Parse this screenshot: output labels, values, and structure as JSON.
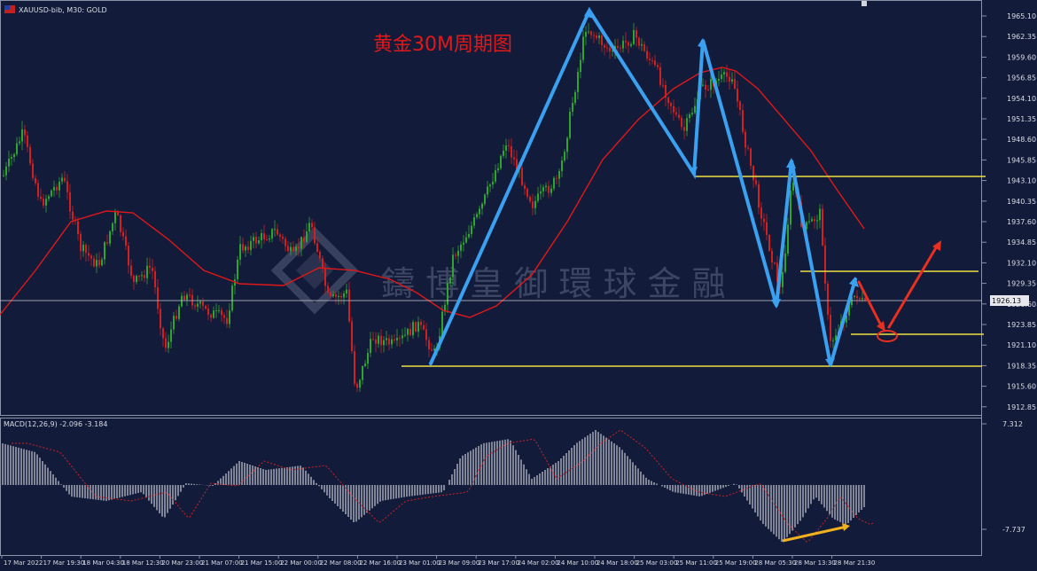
{
  "window": {
    "symbol_header": "XAUUSD-bib, M30: GOLD",
    "annotation_title": "黄金30M周期图",
    "watermark": "鑄 博 皇 御 環 球 金 融",
    "current_price": "1926.13"
  },
  "price_axis": {
    "labels": [
      "1965.10",
      "1962.35",
      "1959.60",
      "1956.85",
      "1954.10",
      "1951.35",
      "1948.60",
      "1945.85",
      "1943.10",
      "1940.35",
      "1937.60",
      "1934.85",
      "1932.10",
      "1929.35",
      "1926.60",
      "1923.85",
      "1921.10",
      "1918.35",
      "1915.60",
      "1912.85"
    ]
  },
  "time_axis": {
    "labels": [
      "17 Mar 2022",
      "17 Mar 19:30",
      "18 Mar 04:30",
      "18 Mar 12:30",
      "20 Mar 23:00",
      "21 Mar 07:00",
      "21 Mar 15:00",
      "22 Mar 00:00",
      "22 Mar 08:00",
      "22 Mar 16:00",
      "23 Mar 01:00",
      "23 Mar 09:00",
      "23 Mar 17:00",
      "24 Mar 02:00",
      "24 Mar 10:00",
      "24 Mar 18:00",
      "25 Mar 03:00",
      "25 Mar 11:00",
      "25 Mar 19:00",
      "28 Mar 05:30",
      "28 Mar 13:30",
      "28 Mar 21:30"
    ]
  },
  "indicator": {
    "label": "MACD(12,26,9) -2.096 -3.184",
    "scale_top": "7.312",
    "scale_bottom": "-7.737"
  },
  "colors": {
    "background": "#131b3a",
    "bull_candle": "#2fa52f",
    "bear_candle": "#d02020",
    "moving_average": "#e01818",
    "zigzag": "#3aa0f0",
    "support_line": "#f0e040",
    "projection": "#e83020",
    "divergence": "#f0b020",
    "title_text": "#e01818"
  },
  "icons": [
    "flag-icon"
  ]
}
